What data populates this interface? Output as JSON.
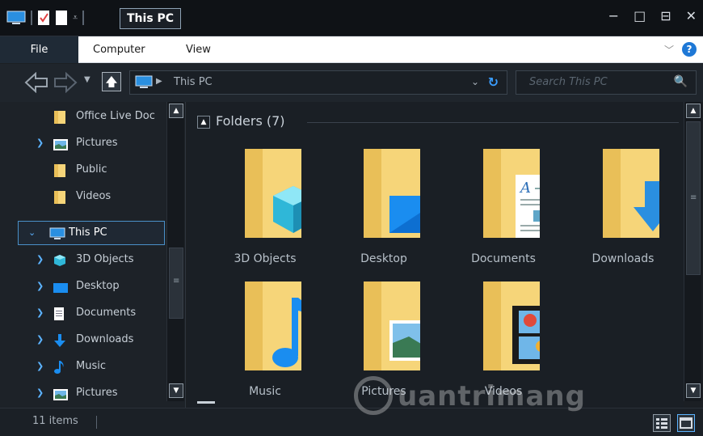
{
  "window": {
    "title": "This PC",
    "controls": [
      "−",
      "□",
      "⊟",
      "✕"
    ]
  },
  "ribbon": {
    "tabs": [
      "File",
      "Computer",
      "View"
    ]
  },
  "address": {
    "path": "This PC",
    "search_placeholder": "Search This PC"
  },
  "nav": {
    "items": [
      {
        "label": "Office Live Doc",
        "icon": "folder-icon",
        "expandable": false
      },
      {
        "label": "Pictures",
        "icon": "pictures-icon",
        "expandable": true
      },
      {
        "label": "Public",
        "icon": "folder-icon",
        "expandable": false
      },
      {
        "label": "Videos",
        "icon": "folder-icon",
        "expandable": false
      },
      {
        "label": "This PC",
        "icon": "monitor-icon",
        "expandable": true,
        "selected": true
      },
      {
        "label": "3D Objects",
        "icon": "cube-icon",
        "expandable": true
      },
      {
        "label": "Desktop",
        "icon": "desktop-icon",
        "expandable": true
      },
      {
        "label": "Documents",
        "icon": "document-icon",
        "expandable": true
      },
      {
        "label": "Downloads",
        "icon": "download-arrow-icon",
        "expandable": true
      },
      {
        "label": "Music",
        "icon": "music-note-icon",
        "expandable": true
      },
      {
        "label": "Pictures",
        "icon": "pictures-icon",
        "expandable": true
      }
    ]
  },
  "content": {
    "group_title": "Folders (7)",
    "folders": [
      {
        "label": "3D Objects",
        "overlay": "cube"
      },
      {
        "label": "Desktop",
        "overlay": "screen"
      },
      {
        "label": "Documents",
        "overlay": "page"
      },
      {
        "label": "Downloads",
        "overlay": "arrow"
      },
      {
        "label": "Music",
        "overlay": "note"
      },
      {
        "label": "Pictures",
        "overlay": "photo"
      },
      {
        "label": "Videos",
        "overlay": "film"
      }
    ]
  },
  "status": {
    "item_count": "11 items"
  },
  "watermark": "uantrimang",
  "colors": {
    "accent": "#1e78d6",
    "folder": "#f8d775",
    "folder_dark": "#e8b94a",
    "background": "#1a1f25"
  }
}
